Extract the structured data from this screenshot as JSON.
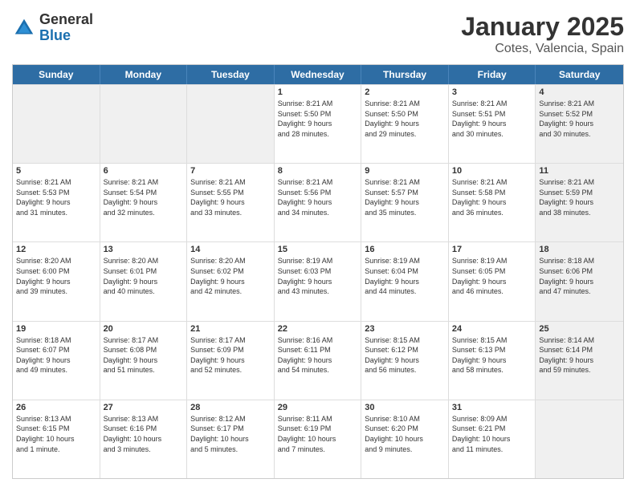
{
  "logo": {
    "general": "General",
    "blue": "Blue"
  },
  "title": "January 2025",
  "subtitle": "Cotes, Valencia, Spain",
  "header_days": [
    "Sunday",
    "Monday",
    "Tuesday",
    "Wednesday",
    "Thursday",
    "Friday",
    "Saturday"
  ],
  "rows": [
    [
      {
        "day": "",
        "lines": [],
        "shaded": true
      },
      {
        "day": "",
        "lines": [],
        "shaded": true
      },
      {
        "day": "",
        "lines": [],
        "shaded": true
      },
      {
        "day": "1",
        "lines": [
          "Sunrise: 8:21 AM",
          "Sunset: 5:50 PM",
          "Daylight: 9 hours",
          "and 28 minutes."
        ],
        "shaded": false
      },
      {
        "day": "2",
        "lines": [
          "Sunrise: 8:21 AM",
          "Sunset: 5:50 PM",
          "Daylight: 9 hours",
          "and 29 minutes."
        ],
        "shaded": false
      },
      {
        "day": "3",
        "lines": [
          "Sunrise: 8:21 AM",
          "Sunset: 5:51 PM",
          "Daylight: 9 hours",
          "and 30 minutes."
        ],
        "shaded": false
      },
      {
        "day": "4",
        "lines": [
          "Sunrise: 8:21 AM",
          "Sunset: 5:52 PM",
          "Daylight: 9 hours",
          "and 30 minutes."
        ],
        "shaded": true
      }
    ],
    [
      {
        "day": "5",
        "lines": [
          "Sunrise: 8:21 AM",
          "Sunset: 5:53 PM",
          "Daylight: 9 hours",
          "and 31 minutes."
        ],
        "shaded": false
      },
      {
        "day": "6",
        "lines": [
          "Sunrise: 8:21 AM",
          "Sunset: 5:54 PM",
          "Daylight: 9 hours",
          "and 32 minutes."
        ],
        "shaded": false
      },
      {
        "day": "7",
        "lines": [
          "Sunrise: 8:21 AM",
          "Sunset: 5:55 PM",
          "Daylight: 9 hours",
          "and 33 minutes."
        ],
        "shaded": false
      },
      {
        "day": "8",
        "lines": [
          "Sunrise: 8:21 AM",
          "Sunset: 5:56 PM",
          "Daylight: 9 hours",
          "and 34 minutes."
        ],
        "shaded": false
      },
      {
        "day": "9",
        "lines": [
          "Sunrise: 8:21 AM",
          "Sunset: 5:57 PM",
          "Daylight: 9 hours",
          "and 35 minutes."
        ],
        "shaded": false
      },
      {
        "day": "10",
        "lines": [
          "Sunrise: 8:21 AM",
          "Sunset: 5:58 PM",
          "Daylight: 9 hours",
          "and 36 minutes."
        ],
        "shaded": false
      },
      {
        "day": "11",
        "lines": [
          "Sunrise: 8:21 AM",
          "Sunset: 5:59 PM",
          "Daylight: 9 hours",
          "and 38 minutes."
        ],
        "shaded": true
      }
    ],
    [
      {
        "day": "12",
        "lines": [
          "Sunrise: 8:20 AM",
          "Sunset: 6:00 PM",
          "Daylight: 9 hours",
          "and 39 minutes."
        ],
        "shaded": false
      },
      {
        "day": "13",
        "lines": [
          "Sunrise: 8:20 AM",
          "Sunset: 6:01 PM",
          "Daylight: 9 hours",
          "and 40 minutes."
        ],
        "shaded": false
      },
      {
        "day": "14",
        "lines": [
          "Sunrise: 8:20 AM",
          "Sunset: 6:02 PM",
          "Daylight: 9 hours",
          "and 42 minutes."
        ],
        "shaded": false
      },
      {
        "day": "15",
        "lines": [
          "Sunrise: 8:19 AM",
          "Sunset: 6:03 PM",
          "Daylight: 9 hours",
          "and 43 minutes."
        ],
        "shaded": false
      },
      {
        "day": "16",
        "lines": [
          "Sunrise: 8:19 AM",
          "Sunset: 6:04 PM",
          "Daylight: 9 hours",
          "and 44 minutes."
        ],
        "shaded": false
      },
      {
        "day": "17",
        "lines": [
          "Sunrise: 8:19 AM",
          "Sunset: 6:05 PM",
          "Daylight: 9 hours",
          "and 46 minutes."
        ],
        "shaded": false
      },
      {
        "day": "18",
        "lines": [
          "Sunrise: 8:18 AM",
          "Sunset: 6:06 PM",
          "Daylight: 9 hours",
          "and 47 minutes."
        ],
        "shaded": true
      }
    ],
    [
      {
        "day": "19",
        "lines": [
          "Sunrise: 8:18 AM",
          "Sunset: 6:07 PM",
          "Daylight: 9 hours",
          "and 49 minutes."
        ],
        "shaded": false
      },
      {
        "day": "20",
        "lines": [
          "Sunrise: 8:17 AM",
          "Sunset: 6:08 PM",
          "Daylight: 9 hours",
          "and 51 minutes."
        ],
        "shaded": false
      },
      {
        "day": "21",
        "lines": [
          "Sunrise: 8:17 AM",
          "Sunset: 6:09 PM",
          "Daylight: 9 hours",
          "and 52 minutes."
        ],
        "shaded": false
      },
      {
        "day": "22",
        "lines": [
          "Sunrise: 8:16 AM",
          "Sunset: 6:11 PM",
          "Daylight: 9 hours",
          "and 54 minutes."
        ],
        "shaded": false
      },
      {
        "day": "23",
        "lines": [
          "Sunrise: 8:15 AM",
          "Sunset: 6:12 PM",
          "Daylight: 9 hours",
          "and 56 minutes."
        ],
        "shaded": false
      },
      {
        "day": "24",
        "lines": [
          "Sunrise: 8:15 AM",
          "Sunset: 6:13 PM",
          "Daylight: 9 hours",
          "and 58 minutes."
        ],
        "shaded": false
      },
      {
        "day": "25",
        "lines": [
          "Sunrise: 8:14 AM",
          "Sunset: 6:14 PM",
          "Daylight: 9 hours",
          "and 59 minutes."
        ],
        "shaded": true
      }
    ],
    [
      {
        "day": "26",
        "lines": [
          "Sunrise: 8:13 AM",
          "Sunset: 6:15 PM",
          "Daylight: 10 hours",
          "and 1 minute."
        ],
        "shaded": false
      },
      {
        "day": "27",
        "lines": [
          "Sunrise: 8:13 AM",
          "Sunset: 6:16 PM",
          "Daylight: 10 hours",
          "and 3 minutes."
        ],
        "shaded": false
      },
      {
        "day": "28",
        "lines": [
          "Sunrise: 8:12 AM",
          "Sunset: 6:17 PM",
          "Daylight: 10 hours",
          "and 5 minutes."
        ],
        "shaded": false
      },
      {
        "day": "29",
        "lines": [
          "Sunrise: 8:11 AM",
          "Sunset: 6:19 PM",
          "Daylight: 10 hours",
          "and 7 minutes."
        ],
        "shaded": false
      },
      {
        "day": "30",
        "lines": [
          "Sunrise: 8:10 AM",
          "Sunset: 6:20 PM",
          "Daylight: 10 hours",
          "and 9 minutes."
        ],
        "shaded": false
      },
      {
        "day": "31",
        "lines": [
          "Sunrise: 8:09 AM",
          "Sunset: 6:21 PM",
          "Daylight: 10 hours",
          "and 11 minutes."
        ],
        "shaded": false
      },
      {
        "day": "",
        "lines": [],
        "shaded": true
      }
    ]
  ]
}
